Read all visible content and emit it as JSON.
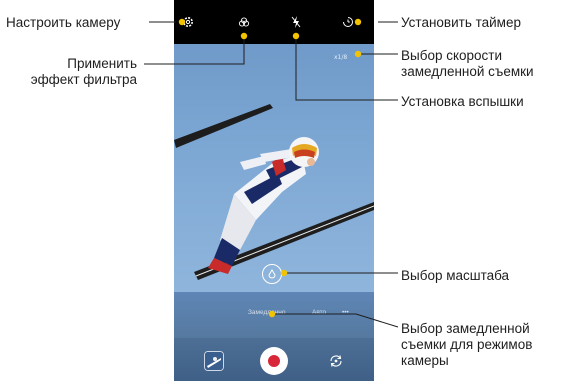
{
  "annotations": {
    "camera_settings": "Настроить камеру",
    "filter_line1": "Применить",
    "filter_line2": "эффект фильтра",
    "timer": "Установить таймер",
    "slowmo_speed_line1": "Выбор скорости",
    "slowmo_speed_line2": "замедленной съемки",
    "flash": "Установка вспышки",
    "zoom": "Выбор масштаба",
    "slowmo_mode_line1": "Выбор замедленной",
    "slowmo_mode_line2": "съемки для режимов",
    "slowmo_mode_line3": "камеры"
  },
  "top_icons": [
    "gear-icon",
    "filter-icon",
    "flash-off-icon",
    "timer-icon"
  ],
  "mode_strip": {
    "modes": [
      "Замедленно",
      "Авто",
      "•••"
    ]
  },
  "speed_label": "x1/8",
  "colors": {
    "callout_line": "#f2c300",
    "shutter_dot": "#d9273a",
    "sky": "#7ea8d4"
  }
}
